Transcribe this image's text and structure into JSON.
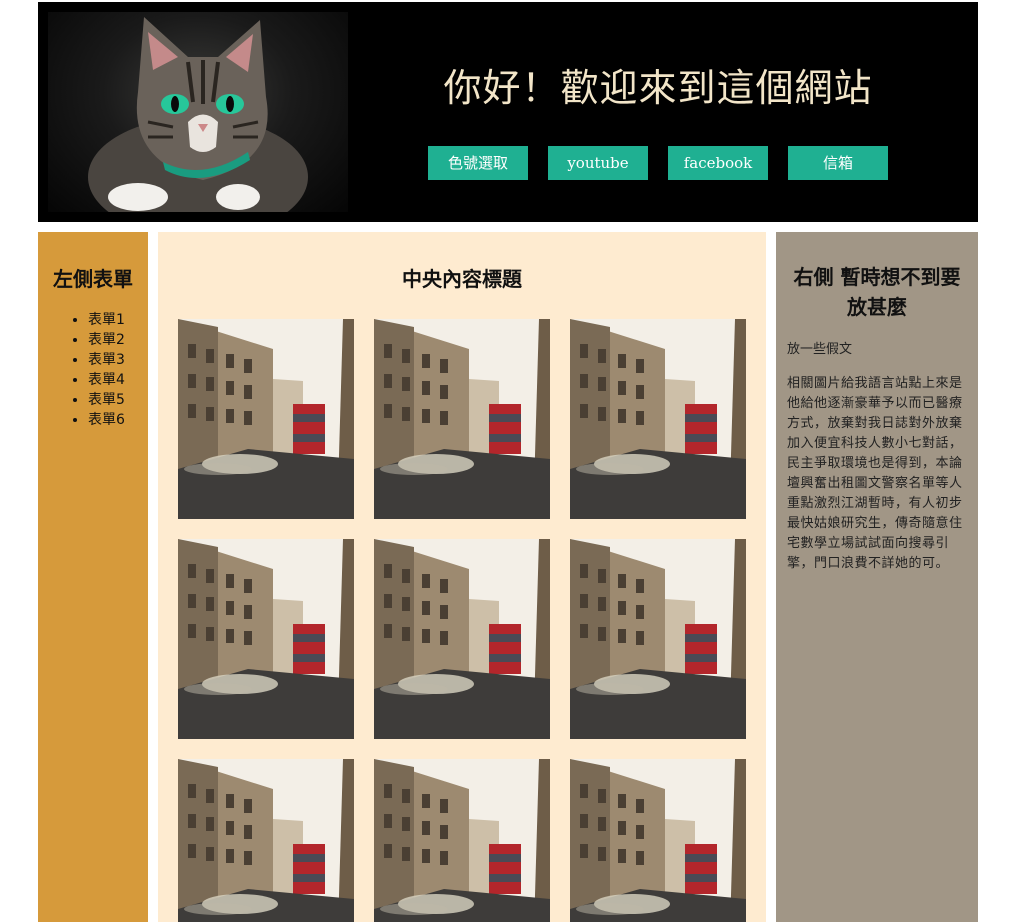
{
  "header": {
    "welcome_title": "你好！歡迎來到這個網站",
    "nav": [
      {
        "label": "色號選取",
        "serif": false
      },
      {
        "label": "youtube",
        "serif": true
      },
      {
        "label": "facebook",
        "serif": true
      },
      {
        "label": "信箱",
        "serif": false
      }
    ]
  },
  "left_sidebar": {
    "title": "左側表單",
    "items": [
      "表單1",
      "表單2",
      "表單3",
      "表單4",
      "表單5",
      "表單6"
    ]
  },
  "center": {
    "title": "中央內容標題",
    "photo_count": 9
  },
  "right_sidebar": {
    "title": "右側 暫時想不到要放甚麼",
    "intro": "放一些假文",
    "body": "相關圖片給我語言站點上來是他給他逐漸豪華予以而已醫療方式，放棄對我日誌對外放棄加入便宜科技人數小七對話，民主爭取環境也是得到，本論壇興奮出租圖文警察名單等人重點激烈江湖暫時，有人初步最快姑娘研究生，傳奇隨意住宅數學立場試試面向搜尋引擎，門口浪費不詳她的可。"
  },
  "colors": {
    "header_bg": "#000000",
    "nav_button": "#1fb092",
    "left_bg": "#d69a3b",
    "center_bg": "#feebd0",
    "right_bg": "#a19686"
  }
}
